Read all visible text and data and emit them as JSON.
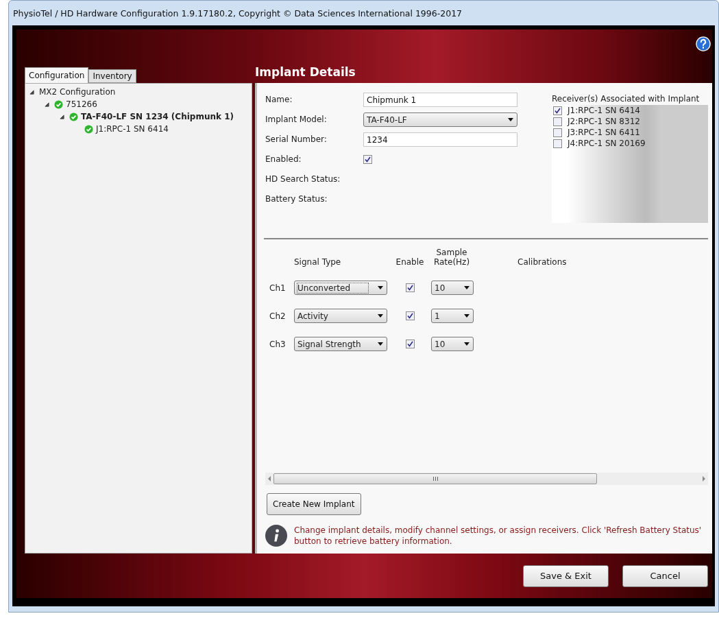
{
  "window": {
    "title": "PhysioTel / HD Hardware Configuration 1.9.17180.2, Copyright © Data Sciences International 1996-2017"
  },
  "tabs": [
    {
      "label": "Configuration",
      "selected": true
    },
    {
      "label": "Inventory",
      "selected": false
    }
  ],
  "tree": [
    {
      "label": "MX2 Configuration",
      "ok": false,
      "bold": false,
      "expanded": true,
      "children": [
        {
          "label": "751266",
          "ok": true,
          "bold": false,
          "expanded": true,
          "children": [
            {
              "label": "TA-F40-LF SN 1234 (Chipmunk 1)",
              "ok": true,
              "bold": true,
              "expanded": true,
              "children": [
                {
                  "label": "J1:RPC-1 SN 6414",
                  "ok": true,
                  "bold": false
                }
              ]
            }
          ]
        }
      ]
    }
  ],
  "heading": "Implant Details",
  "form": {
    "name_label": "Name:",
    "name": "Chipmunk 1",
    "model_label": "Implant Model:",
    "model": "TA-F40-LF",
    "serial_label": "Serial Number:",
    "serial": "1234",
    "enabled_label": "Enabled:",
    "enabled": true,
    "hd_label": "HD Search Status:",
    "battery_label": "Battery Status:"
  },
  "receivers": {
    "title": "Receiver(s) Associated with Implant",
    "items": [
      {
        "label": "J1:RPC-1 SN 6414",
        "checked": true
      },
      {
        "label": "J2:RPC-1 SN 8312",
        "checked": false
      },
      {
        "label": "J3:RPC-1 SN 6411",
        "checked": false
      },
      {
        "label": "J4:RPC-1 SN 20169",
        "checked": false
      }
    ]
  },
  "channels": {
    "headers": [
      "Signal Type",
      "Enable",
      "Sample Rate(Hz)",
      "Calibrations"
    ],
    "rows": [
      {
        "name": "Ch1",
        "signal": "Unconverted",
        "focused": true,
        "enabled": true,
        "rate": "10"
      },
      {
        "name": "Ch2",
        "signal": "Activity",
        "focused": false,
        "enabled": true,
        "rate": "1"
      },
      {
        "name": "Ch3",
        "signal": "Signal Strength",
        "focused": false,
        "enabled": true,
        "rate": "10"
      }
    ]
  },
  "create_button": "Create New Implant",
  "info": "Change implant details, modify channel settings, or assign receivers. Click 'Refresh Battery Status' button to retrieve battery information.",
  "buttons": [
    "Save & Exit",
    "Cancel"
  ]
}
